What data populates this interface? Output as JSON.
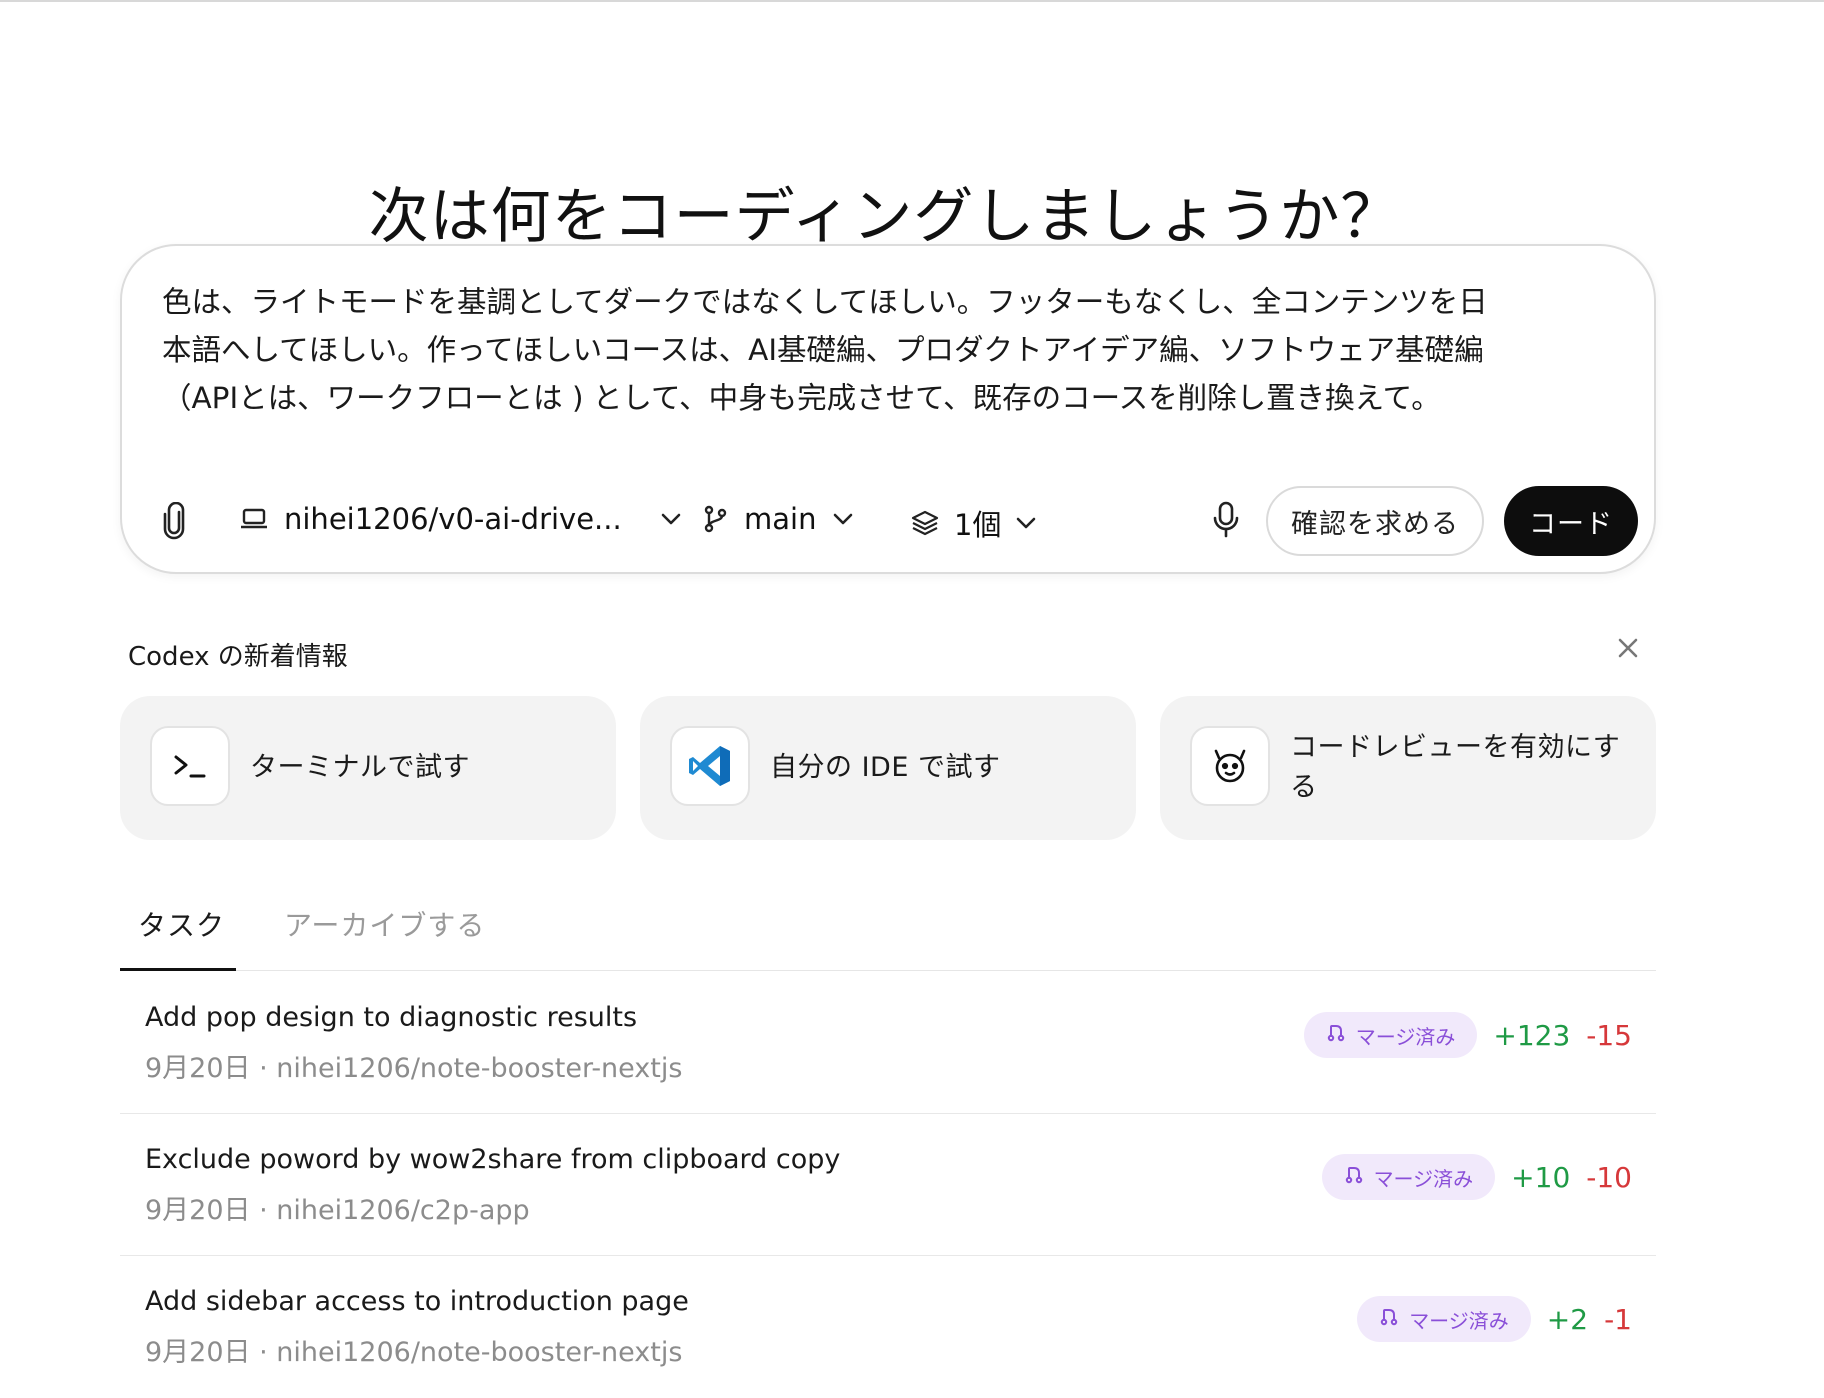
{
  "page": {
    "title": "次は何をコーディングしましょうか？"
  },
  "composer": {
    "prompt": "色は、ライトモードを基調としてダークではなくしてほしい。フッターもなくし、全コンテンツを日\n本語へしてほしい。作ってほしいコースは、AI基礎編、プロダクトアイデア編、ソフトウェア基礎編\n（APIとは、ワークフローとは ) として、中身も完成させて、既存のコースを削除し置き換えて。",
    "repo": "nihei1206/v0-ai-drive...",
    "branch": "main",
    "count": "1個",
    "ask_label": "確認を求める",
    "code_label": "コード",
    "icons": [
      "paperclip-icon",
      "laptop-icon",
      "git-branch-icon",
      "layers-icon",
      "microphone-icon",
      "chevron-down-icon"
    ]
  },
  "news": {
    "title": "Codex の新着情報",
    "cards": [
      {
        "label": "ターミナルで試す",
        "icon": "terminal-icon"
      },
      {
        "label": "自分の IDE で試す",
        "icon": "vscode-icon"
      },
      {
        "label": "コードレビューを有効にす\nる",
        "icon": "codex-bot-icon"
      }
    ]
  },
  "tabs": [
    {
      "label": "タスク",
      "active": true
    },
    {
      "label": "アーカイブする",
      "active": false
    }
  ],
  "tasks": [
    {
      "title": "Add pop design to diagnostic results",
      "meta": "9月20日 · nihei1206/note-booster-nextjs",
      "status": "マージ済み",
      "additions": "+123",
      "deletions": "-15"
    },
    {
      "title": "Exclude poword by wow2share from clipboard copy",
      "meta": "9月20日 · nihei1206/c2p-app",
      "status": "マージ済み",
      "additions": "+10",
      "deletions": "-10"
    },
    {
      "title": "Add sidebar access to introduction page",
      "meta": "9月20日 · nihei1206/note-booster-nextjs",
      "status": "マージ済み",
      "additions": "+2",
      "deletions": "-1"
    }
  ],
  "colors": {
    "accent_dark": "#0d0d0d",
    "badge_bg": "#f1e9fb",
    "badge_text": "#8a4fd8",
    "additions": "#1f9a45",
    "deletions": "#d6383a"
  }
}
